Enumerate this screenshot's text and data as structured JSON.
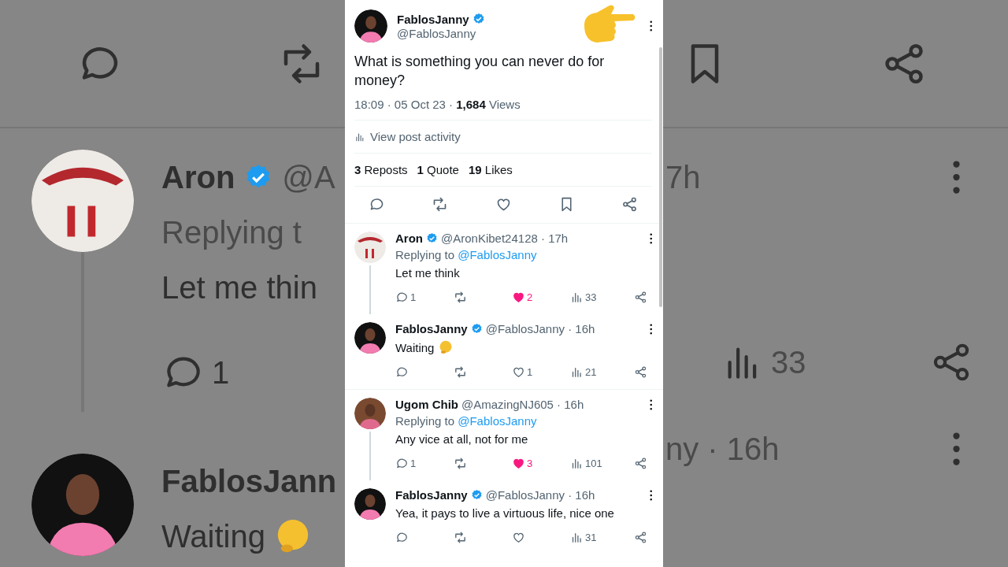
{
  "background": {
    "left": {
      "name": "Aron",
      "handle": "@A",
      "replying": "Replying t",
      "text": "Let me thin",
      "reply_count": "1",
      "name2": "FablosJann",
      "text2": "Waiting"
    },
    "right": {
      "time": "7h",
      "views": "33",
      "meta2": "ny · 16h"
    }
  },
  "post": {
    "author": "FablosJanny",
    "verified": true,
    "handle": "@FablosJanny",
    "text": "What is something you can never do for money?",
    "meta": "18:09 · 05 Oct 23 · **1,684** Views",
    "activity": "View post activity",
    "stats": [
      {
        "count": "3",
        "label": "Reposts"
      },
      {
        "count": "1",
        "label": "Quote"
      },
      {
        "count": "19",
        "label": "Likes"
      }
    ]
  },
  "replies": [
    {
      "kind": "plain",
      "name": "Aron",
      "verified": true,
      "meta": "@AronKibet24128 · 17h",
      "replying_label": "Replying to",
      "replying_to": "@FablosJanny",
      "text": "Let me think",
      "replies": "1",
      "likes": "2",
      "liked": true,
      "views": "33",
      "connected": true
    },
    {
      "kind": "emoji",
      "name": "FablosJanny",
      "verified": true,
      "meta": "@FablosJanny · 16h",
      "text": "Waiting",
      "likes": "1",
      "liked": false,
      "views": "21",
      "connected": false
    },
    {
      "kind": "plain",
      "name": "Ugom Chib",
      "verified": false,
      "meta": "@AmazingNJ605 · 16h",
      "replying_label": "Replying to",
      "replying_to": "@FablosJanny",
      "text": "Any vice at all, not for me",
      "replies": "1",
      "likes": "3",
      "liked": true,
      "views": "101",
      "connected": true
    },
    {
      "kind": "plain",
      "name": "FablosJanny",
      "verified": true,
      "meta": "@FablosJanny · 16h",
      "text": "Yea, it pays to live a virtuous life, nice one",
      "liked": false,
      "views": "31",
      "connected": false
    }
  ]
}
